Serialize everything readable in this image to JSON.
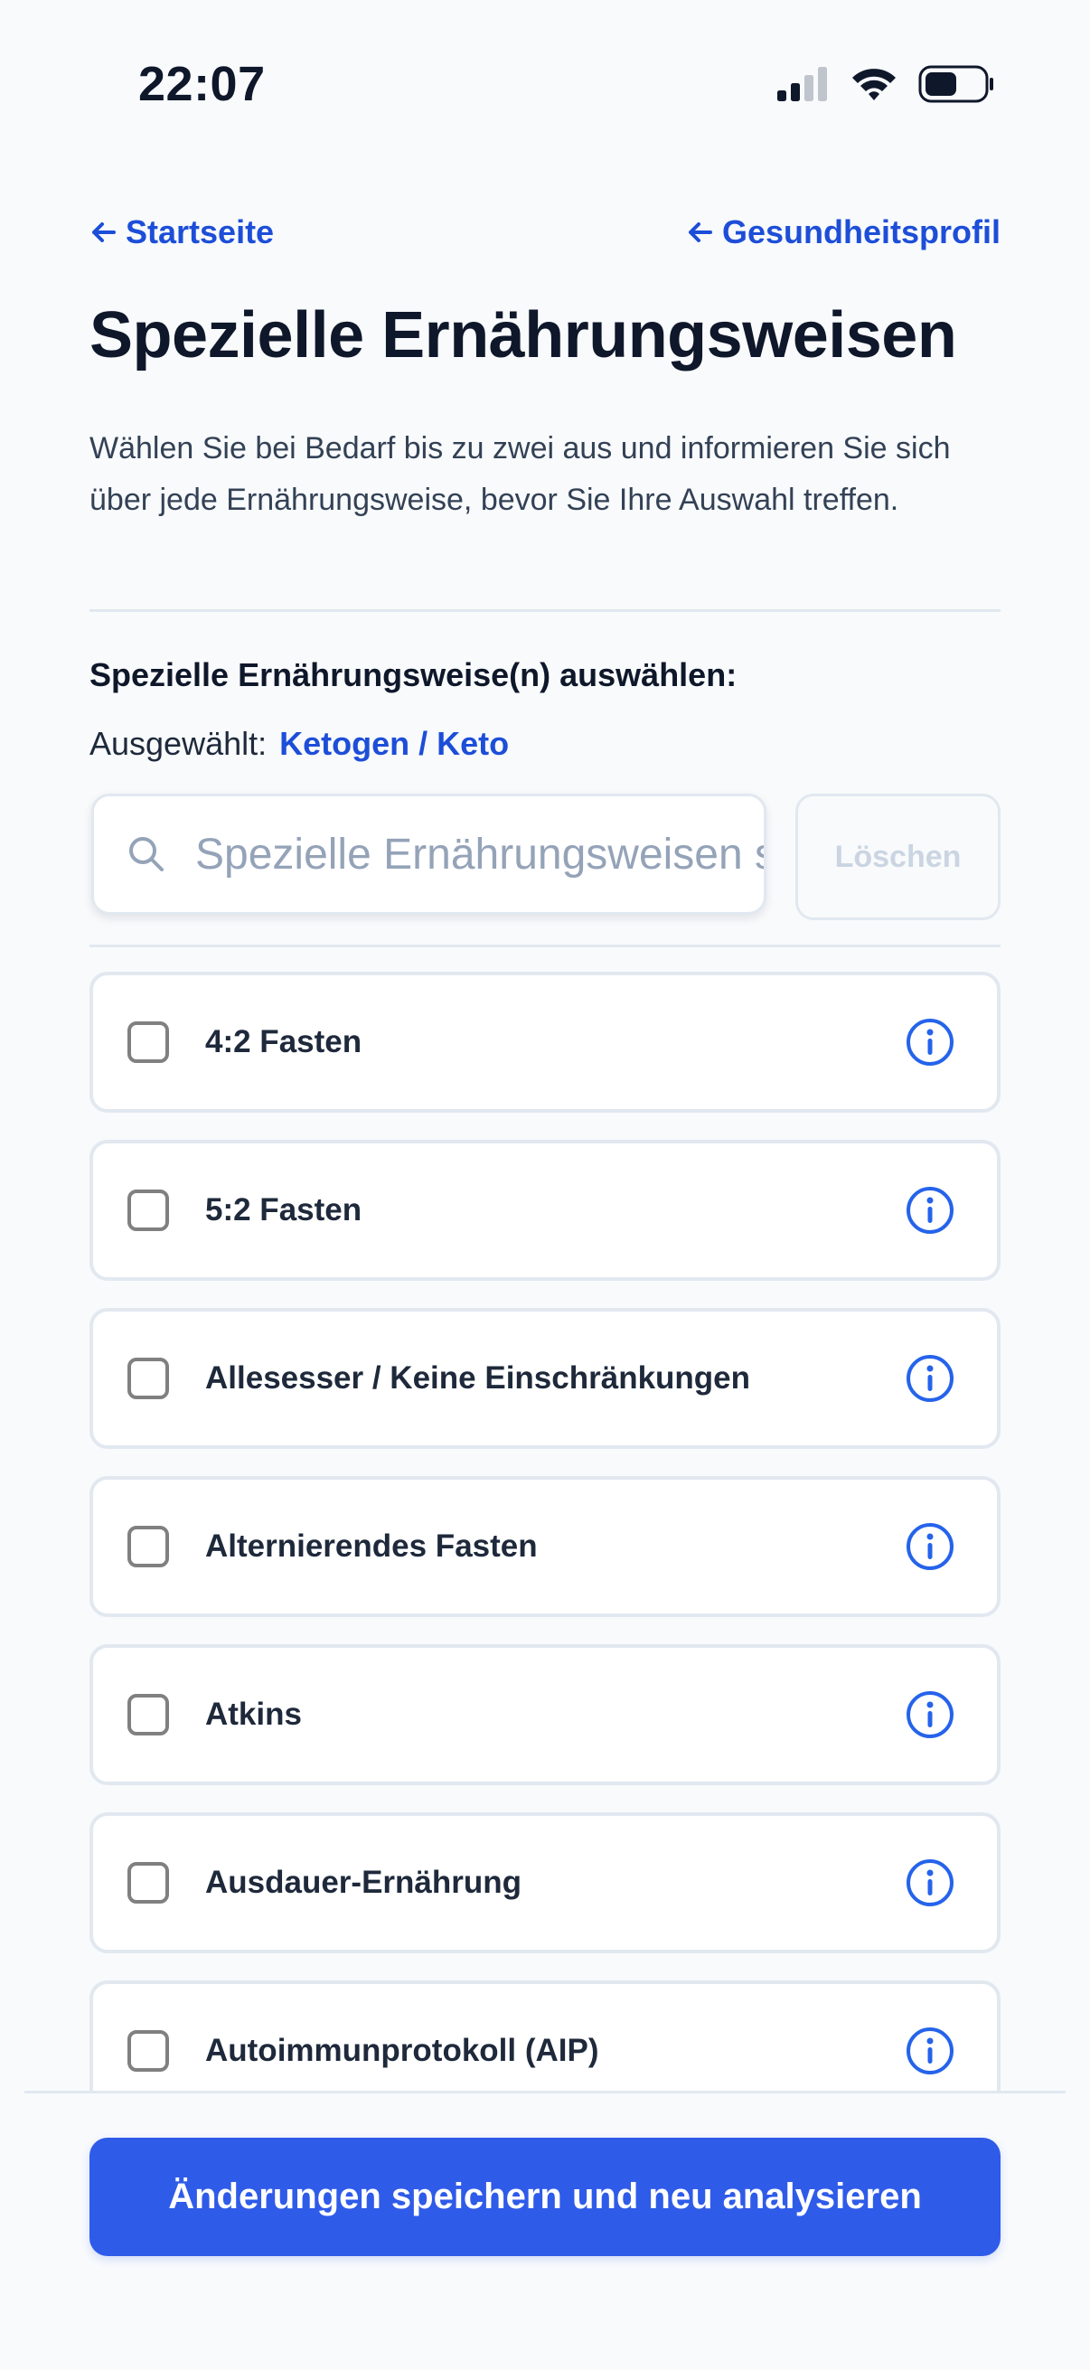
{
  "status_bar": {
    "time": "22:07"
  },
  "nav": {
    "back_home_label": "Startseite",
    "back_profile_label": "Gesundheitsprofil"
  },
  "page": {
    "title": "Spezielle Ernährungsweisen",
    "intro": "Wählen Sie bei Bedarf bis zu zwei aus und informieren Sie sich über jede Ernährungsweise, bevor Sie Ihre Auswahl treffen."
  },
  "selection": {
    "section_label": "Spezielle Ernährungsweise(n) auswählen:",
    "selected_prefix": "Ausgewählt:",
    "selected_value": "Ketogen / Keto"
  },
  "search": {
    "placeholder": "Spezielle Ernährungsweisen suchen",
    "value": ""
  },
  "clear_button_label": "Löschen",
  "diets": [
    {
      "label": "4:2 Fasten",
      "checked": false
    },
    {
      "label": "5:2 Fasten",
      "checked": false
    },
    {
      "label": "Allesesser / Keine Einschränkungen",
      "checked": false
    },
    {
      "label": "Alternierendes Fasten",
      "checked": false
    },
    {
      "label": "Atkins",
      "checked": false
    },
    {
      "label": "Ausdauer-Ernährung",
      "checked": false
    },
    {
      "label": "Autoimmunprotokoll (AIP)",
      "checked": false
    }
  ],
  "footer": {
    "save_button_label": "Änderungen speichern und neu analysieren"
  },
  "colors": {
    "accent": "#2f5be9",
    "link": "#1d4ed8",
    "background": "#f8fafc",
    "card_border": "#e2e8f0"
  },
  "icons": {
    "back": "arrow-left-icon",
    "search": "search-icon",
    "info": "info-icon",
    "signal": "signal-icon",
    "wifi": "wifi-icon",
    "battery": "battery-icon"
  }
}
